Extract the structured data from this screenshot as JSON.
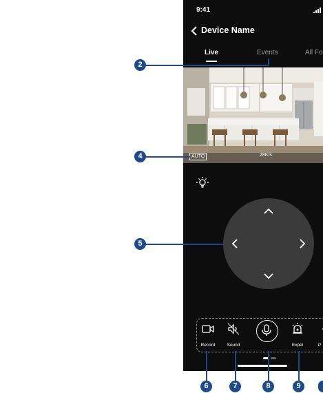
{
  "status_bar": {
    "time": "9:41"
  },
  "header": {
    "title": "Device Name"
  },
  "tabs": [
    {
      "label": "Live",
      "active": true
    },
    {
      "label": "Events",
      "active": false
    },
    {
      "label": "All Fo",
      "active": false
    }
  ],
  "video": {
    "mode_badge": "AUTO",
    "bitrate": "28K/s"
  },
  "toolbar": {
    "items": [
      {
        "label": "Record",
        "icon": "video-camera-icon"
      },
      {
        "label": "Sound",
        "icon": "speaker-muted-icon"
      },
      {
        "label": "",
        "icon": "microphone-icon"
      },
      {
        "label": "Expel",
        "icon": "alarm-light-icon"
      },
      {
        "label": "P",
        "icon": "partial-icon"
      }
    ]
  },
  "callouts": {
    "c2": "2",
    "c4": "4",
    "c5": "5",
    "c6": "6",
    "c7": "7",
    "c8": "8",
    "c9": "9"
  },
  "colors": {
    "callout": "#1e4a8c",
    "screen_bg": "#0d0d0d",
    "dpad": "#3b3b3b"
  }
}
